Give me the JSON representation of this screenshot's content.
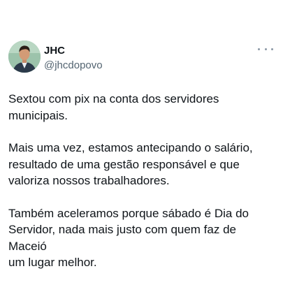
{
  "author": {
    "display_name": "JHC",
    "handle": "@jhcdopovo",
    "avatar_icon": "profile-photo"
  },
  "menu_icon": "more-horizontal-icon",
  "tweet": {
    "paragraphs": [
      "Sextou com pix na conta dos servidores\nmunicipais.",
      "Mais uma vez, estamos antecipando o salário,\nresultado de uma gestão responsável e que\nvaloriza nossos trabalhadores.",
      "Também aceleramos porque sábado é Dia do\nServidor, nada mais justo com quem faz de Maceió\num lugar melhor."
    ]
  },
  "colors": {
    "text": "#0f1419",
    "secondary": "#536471",
    "background": "#ffffff"
  }
}
